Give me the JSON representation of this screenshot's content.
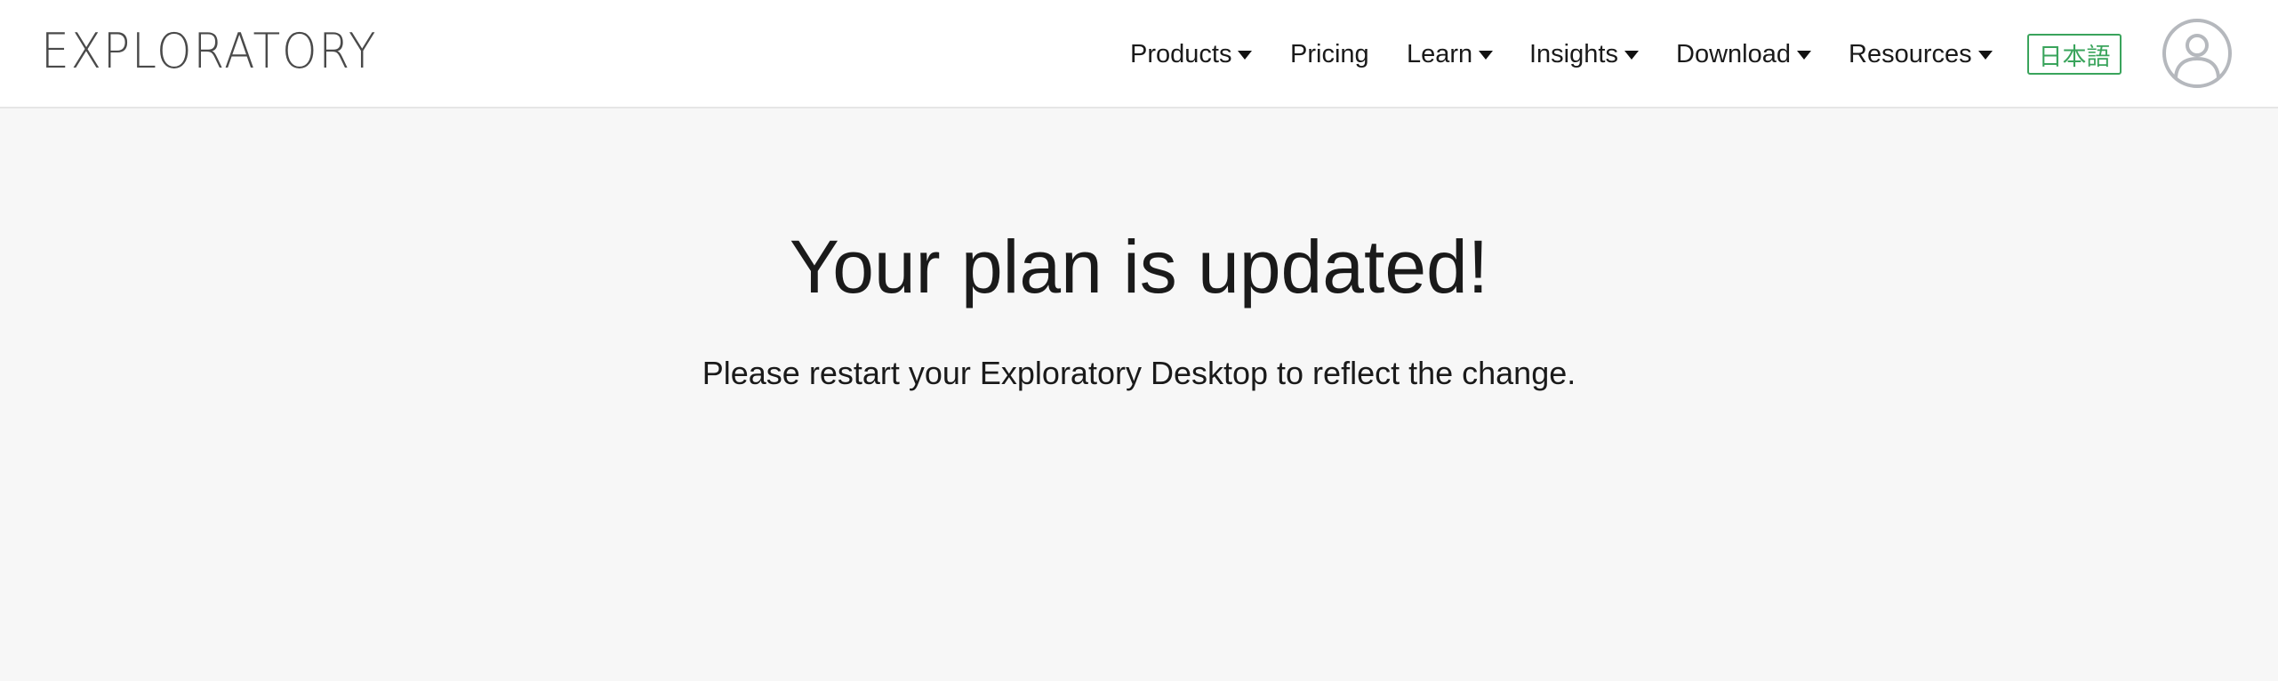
{
  "header": {
    "logo_text": "EXPLORATORY",
    "nav": [
      {
        "label": "Products",
        "has_dropdown": true
      },
      {
        "label": "Pricing",
        "has_dropdown": false
      },
      {
        "label": "Learn",
        "has_dropdown": true
      },
      {
        "label": "Insights",
        "has_dropdown": true
      },
      {
        "label": "Download",
        "has_dropdown": true
      },
      {
        "label": "Resources",
        "has_dropdown": true
      }
    ],
    "language_button": "日本語",
    "avatar_icon": "user-avatar-icon"
  },
  "main": {
    "title": "Your plan is updated!",
    "message": "Please restart your Exploratory Desktop to reflect the change."
  },
  "colors": {
    "page_background": "#f7f7f7",
    "header_background": "#ffffff",
    "language_accent": "#3aa45c",
    "avatar_gray": "#b5b8bd",
    "text": "#1a1a1a"
  }
}
